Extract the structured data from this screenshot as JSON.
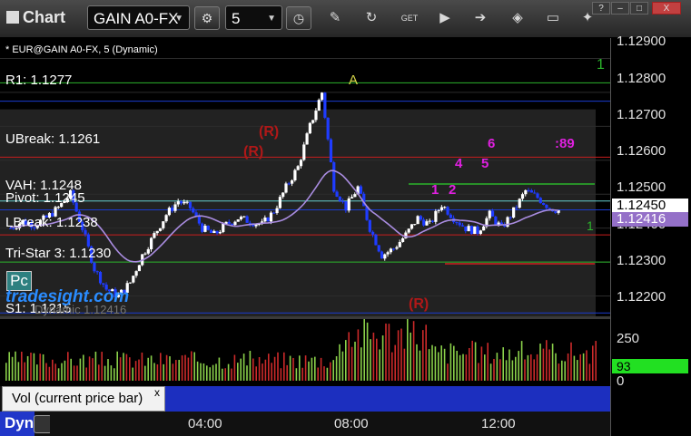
{
  "window": {
    "title": "Chart",
    "min_label": "?",
    "close_label": "X"
  },
  "toolbar": {
    "symbol_value": "GAIN A0-FX",
    "interval_value": "5",
    "icons": [
      "settings-gear-icon",
      "clock-icon",
      "pencil-draw-icon",
      "refresh-icon",
      "get-data-icon",
      "play-icon",
      "arrow-icon",
      "tag-icon",
      "message-icon",
      "twitter-icon"
    ]
  },
  "chart": {
    "caption": "* EUR@GAIN A0-FX, 5 (Dynamic)",
    "levels": {
      "r1": "R1: 1.1277",
      "ubreak": "UBreak: 1.1261",
      "vah": "VAH: 1.1248",
      "pivot": "Pivot: 1.1245",
      "lbreak": "LBreak: 1.1238",
      "tristar": "Tri-Star 3: 1.1230",
      "s1": "S1: 1.1215"
    },
    "pc_label": "Pc",
    "watermark": "tradesight.com",
    "faint_text": "Dynamic 1.12416",
    "annotations": {
      "a": "A",
      "r_marks": [
        "(R)",
        "(R)",
        "(R)"
      ],
      "magenta": [
        "1",
        "2",
        "4",
        "5",
        "6",
        ":89"
      ],
      "green_right": "1",
      "green_right2": "1"
    },
    "price_axis": [
      "1.12900",
      "1.12800",
      "1.12700",
      "1.12600",
      "1.12500",
      "1.12400",
      "1.12300",
      "1.12200"
    ],
    "last_price": "1.12450",
    "ma_price": "1.12416",
    "colors": {
      "up": "#ffffff",
      "down": "#1f3cff",
      "r1": "#1a3bd0",
      "ubreak": "#c81e1e",
      "green_line": "#2bb52b",
      "ma": "#a98ce0"
    }
  },
  "chart_data": {
    "type": "line",
    "title": "* EUR@GAIN A0-FX, 5 (Dynamic)",
    "xlabel": "",
    "ylabel": "",
    "x_ticks": [
      "04:00",
      "08:00",
      "12:00"
    ],
    "ylim": [
      1.1214,
      1.1296
    ],
    "series": [
      {
        "values": [
          1.124,
          1.1242,
          1.1241,
          1.1243,
          1.1246,
          1.125,
          1.124,
          1.1228,
          1.1222,
          1.122,
          1.1224,
          1.1232,
          1.1238,
          1.1244,
          1.1248,
          1.1246,
          1.124,
          1.1238,
          1.1241,
          1.1243,
          1.1242,
          1.1241,
          1.1245,
          1.1252,
          1.1258,
          1.127,
          1.128,
          1.1252,
          1.1246,
          1.1252,
          1.124,
          1.1232,
          1.1234,
          1.1238,
          1.1243,
          1.1241,
          1.1247,
          1.1243,
          1.124,
          1.1239,
          1.1244,
          1.124,
          1.1245,
          1.1251,
          1.1249,
          1.1246,
          1.1245
        ]
      }
    ],
    "volume": {
      "axis": [
        "250",
        "0"
      ],
      "last": "93",
      "label": "Vol (current price bar)"
    }
  },
  "bottom": {
    "vol_tab": "Vol (current price bar)",
    "vol_close": "x",
    "dyn_label": "Dyn",
    "time_labels": [
      "04:00",
      "08:00",
      "12:00"
    ]
  },
  "volume_axis": {
    "top": "250",
    "bottom": "0",
    "current": "93"
  }
}
